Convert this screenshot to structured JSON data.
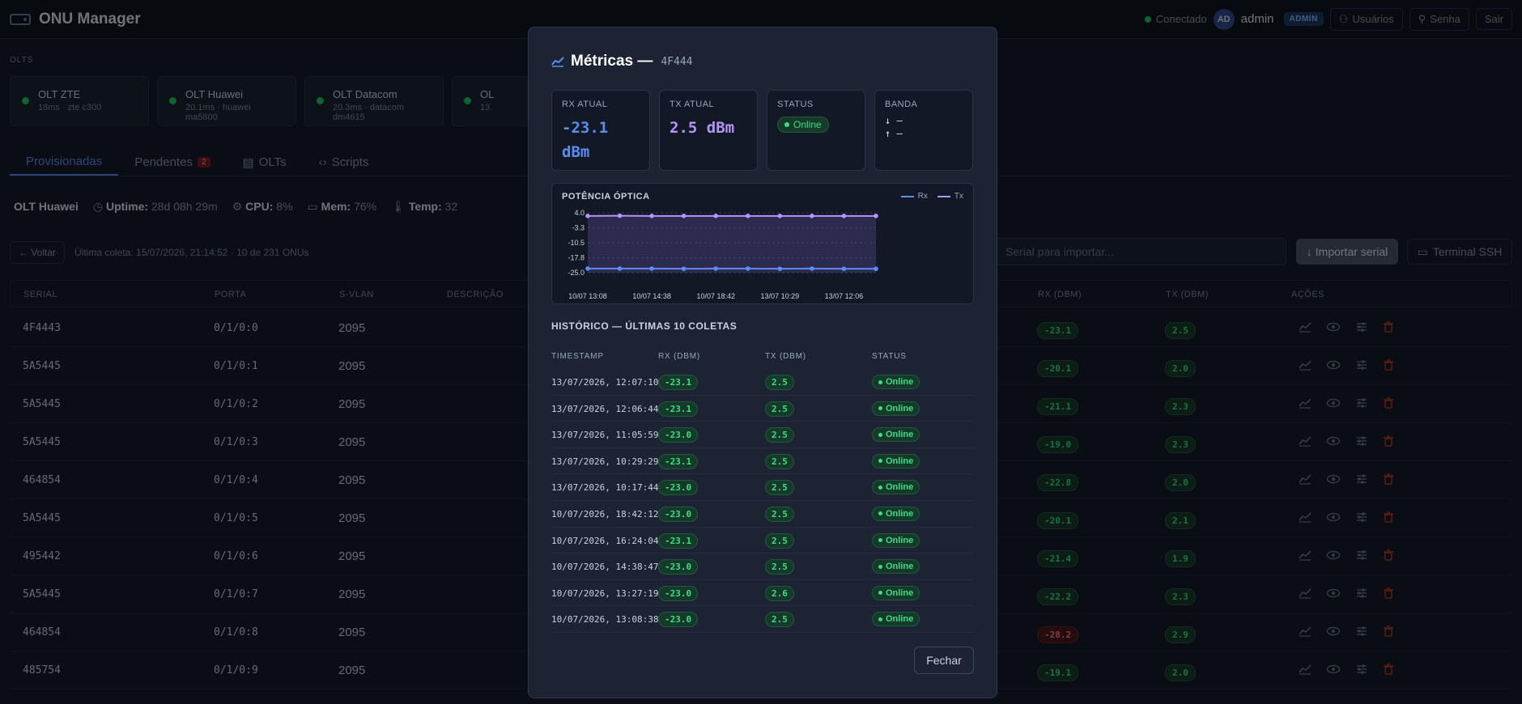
{
  "app": {
    "title": "ONU Manager"
  },
  "topbar": {
    "status": "Conectado",
    "avatar": "AD",
    "user": "admin",
    "role": "ADMIN",
    "users_btn": "Usuários",
    "password_btn": "Senha",
    "logout_btn": "Sair"
  },
  "olts_label": "OLTS",
  "olts": [
    {
      "name": "OLT ZTE",
      "meta": "18ms · zte c300"
    },
    {
      "name": "OLT Huawei",
      "meta": "20.1ms · huawei ma5800"
    },
    {
      "name": "OLT Datacom",
      "meta": "20.3ms · datacom dm4615"
    },
    {
      "name": "OL",
      "meta": "13."
    }
  ],
  "tabs": [
    {
      "label": "Provisionadas"
    },
    {
      "label": "Pendentes",
      "badge": "2"
    },
    {
      "label": "OLTs"
    },
    {
      "label": "Scripts"
    }
  ],
  "olt_status": {
    "name": "OLT Huawei",
    "uptime_label": "Uptime:",
    "uptime": "28d 08h 29m",
    "cpu_label": "CPU:",
    "cpu": "8%",
    "mem_label": "Mem:",
    "mem": "76%",
    "temp_label": "Temp:",
    "temp": "32"
  },
  "toolbar": {
    "back": "← Voltar",
    "last_collect": "Última coleta: 15/07/2026, 21:14:52 · 10 de 231 ONUs",
    "import_placeholder": "Serial para importar...",
    "import_btn": "Importar serial",
    "ssh_btn": "Terminal SSH"
  },
  "table": {
    "headers": {
      "serial": "SERIAL",
      "port": "PORTA",
      "svlan": "S-VLAN",
      "desc": "DESCRIÇÃO",
      "rx": "RX (DBM)",
      "tx": "TX (DBM)",
      "actions": "AÇÕES"
    },
    "rows": [
      {
        "serial": "4F4443",
        "port": "0/1/0:0",
        "vlan": "2095",
        "rx": "-23.1",
        "tx": "2.5",
        "rx_bad": false
      },
      {
        "serial": "5A5445",
        "port": "0/1/0:1",
        "vlan": "2095",
        "rx": "-20.1",
        "tx": "2.0",
        "rx_bad": false
      },
      {
        "serial": "5A5445",
        "port": "0/1/0:2",
        "vlan": "2095",
        "rx": "-21.1",
        "tx": "2.3",
        "rx_bad": false
      },
      {
        "serial": "5A5445",
        "port": "0/1/0:3",
        "vlan": "2095",
        "rx": "-19.0",
        "tx": "2.3",
        "rx_bad": false
      },
      {
        "serial": "464854",
        "port": "0/1/0:4",
        "vlan": "2095",
        "rx": "-22.8",
        "tx": "2.0",
        "rx_bad": false
      },
      {
        "serial": "5A5445",
        "port": "0/1/0:5",
        "vlan": "2095",
        "rx": "-20.1",
        "tx": "2.1",
        "rx_bad": false
      },
      {
        "serial": "495442",
        "port": "0/1/0:6",
        "vlan": "2095",
        "rx": "-21.4",
        "tx": "1.9",
        "rx_bad": false
      },
      {
        "serial": "5A5445",
        "port": "0/1/0:7",
        "vlan": "2095",
        "rx": "-22.2",
        "tx": "2.3",
        "rx_bad": false
      },
      {
        "serial": "464854",
        "port": "0/1/0:8",
        "vlan": "2095",
        "rx": "-28.2",
        "tx": "2.9",
        "rx_bad": true
      },
      {
        "serial": "485754",
        "port": "0/1/0:9",
        "vlan": "2095",
        "rx": "-19.1",
        "tx": "2.0",
        "rx_bad": false
      }
    ]
  },
  "modal": {
    "title": "Métricas —",
    "serial": "4F444",
    "stats": {
      "rx_label": "RX ATUAL",
      "rx_value": "-23.1 dBm",
      "tx_label": "TX ATUAL",
      "tx_value": "2.5 dBm",
      "status_label": "STATUS",
      "status_value": "Online",
      "band_label": "BANDA",
      "band_down": "↓ —",
      "band_up": "↑ —"
    },
    "chart_title": "POTÊNCIA ÓPTICA",
    "history_title": "HISTÓRICO — ÚLTIMAS 10 COLETAS",
    "history_headers": {
      "ts": "TIMESTAMP",
      "rx": "RX (DBM)",
      "tx": "TX (DBM)",
      "status": "STATUS"
    },
    "history": [
      {
        "ts": "13/07/2026, 12:07:10",
        "rx": "-23.1",
        "tx": "2.5",
        "status": "Online"
      },
      {
        "ts": "13/07/2026, 12:06:44",
        "rx": "-23.1",
        "tx": "2.5",
        "status": "Online"
      },
      {
        "ts": "13/07/2026, 11:05:59",
        "rx": "-23.0",
        "tx": "2.5",
        "status": "Online"
      },
      {
        "ts": "13/07/2026, 10:29:29",
        "rx": "-23.1",
        "tx": "2.5",
        "status": "Online"
      },
      {
        "ts": "13/07/2026, 10:17:44",
        "rx": "-23.0",
        "tx": "2.5",
        "status": "Online"
      },
      {
        "ts": "10/07/2026, 18:42:12",
        "rx": "-23.0",
        "tx": "2.5",
        "status": "Online"
      },
      {
        "ts": "10/07/2026, 16:24:04",
        "rx": "-23.1",
        "tx": "2.5",
        "status": "Online"
      },
      {
        "ts": "10/07/2026, 14:38:47",
        "rx": "-23.0",
        "tx": "2.5",
        "status": "Online"
      },
      {
        "ts": "10/07/2026, 13:27:19",
        "rx": "-23.0",
        "tx": "2.6",
        "status": "Online"
      },
      {
        "ts": "10/07/2026, 13:08:38",
        "rx": "-23.0",
        "tx": "2.5",
        "status": "Online"
      }
    ],
    "close_btn": "Fechar"
  },
  "colors": {
    "rx": "#5b8def",
    "tx": "#b395f5",
    "accent": "#5b8def",
    "online": "#3ddc84",
    "bad": "#ff7b84"
  },
  "chart_data": {
    "type": "line",
    "title": "POTÊNCIA ÓPTICA",
    "x": [
      "10/07 13:08",
      "10/07 13:27",
      "10/07 14:38",
      "10/07 16:24",
      "10/07 18:42",
      "13/07 10:17",
      "13/07 10:29",
      "13/07 11:05",
      "13/07 12:06",
      "13/07 12:07"
    ],
    "x_tick_labels": [
      "10/07 13:08",
      "10/07 14:38",
      "10/07 18:42",
      "13/07 10:29",
      "13/07 12:06"
    ],
    "y_tick_labels": [
      "4.0",
      "-3.3",
      "-10.5",
      "-17.8",
      "-25.0"
    ],
    "ylim": [
      -25.0,
      4.0
    ],
    "series": [
      {
        "name": "Rx",
        "values": [
          -23.0,
          -23.0,
          -23.0,
          -23.1,
          -23.0,
          -23.0,
          -23.1,
          -23.0,
          -23.1,
          -23.1
        ]
      },
      {
        "name": "Tx",
        "values": [
          2.5,
          2.6,
          2.5,
          2.5,
          2.5,
          2.5,
          2.5,
          2.5,
          2.5,
          2.5
        ]
      }
    ],
    "grid": true,
    "legend": "top-right"
  }
}
